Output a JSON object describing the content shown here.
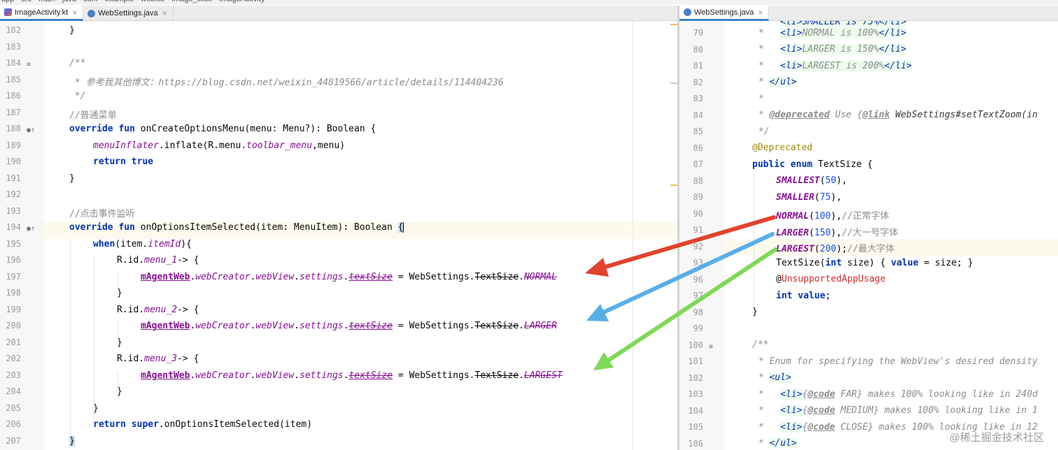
{
  "breadcrumb": [
    "app",
    "src",
    "main",
    "java",
    "com",
    "example",
    "webfile",
    "image_click",
    "ImageActivity"
  ],
  "left_tabs": [
    {
      "label": "ImageActivity.kt",
      "type": "kt",
      "active": true
    },
    {
      "label": "WebSettings.java",
      "type": "java",
      "active": false
    }
  ],
  "right_tabs": [
    {
      "label": "WebSettings.java",
      "type": "java",
      "active": true
    }
  ],
  "left_lines": [
    {
      "n": "182",
      "g": ""
    },
    {
      "n": "183",
      "g": ""
    },
    {
      "n": "184",
      "g": "≡"
    },
    {
      "n": "185",
      "g": ""
    },
    {
      "n": "186",
      "g": ""
    },
    {
      "n": "187",
      "g": ""
    },
    {
      "n": "188",
      "g": "●↑"
    },
    {
      "n": "189",
      "g": ""
    },
    {
      "n": "190",
      "g": ""
    },
    {
      "n": "191",
      "g": ""
    },
    {
      "n": "192",
      "g": ""
    },
    {
      "n": "193",
      "g": ""
    },
    {
      "n": "194",
      "g": "●↑"
    },
    {
      "n": "195",
      "g": ""
    },
    {
      "n": "196",
      "g": ""
    },
    {
      "n": "197",
      "g": ""
    },
    {
      "n": "198",
      "g": ""
    },
    {
      "n": "199",
      "g": ""
    },
    {
      "n": "200",
      "g": ""
    },
    {
      "n": "201",
      "g": ""
    },
    {
      "n": "202",
      "g": ""
    },
    {
      "n": "203",
      "g": ""
    },
    {
      "n": "204",
      "g": ""
    },
    {
      "n": "205",
      "g": ""
    },
    {
      "n": "206",
      "g": ""
    },
    {
      "n": "207",
      "g": ""
    }
  ],
  "right_lines": [
    {
      "n": "79",
      "g": ""
    },
    {
      "n": "80",
      "g": ""
    },
    {
      "n": "81",
      "g": ""
    },
    {
      "n": "82",
      "g": ""
    },
    {
      "n": "83",
      "g": ""
    },
    {
      "n": "84",
      "g": ""
    },
    {
      "n": "85",
      "g": ""
    },
    {
      "n": "86",
      "g": ""
    },
    {
      "n": "87",
      "g": ""
    },
    {
      "n": "88",
      "g": ""
    },
    {
      "n": "89",
      "g": ""
    },
    {
      "n": "90",
      "g": ""
    },
    {
      "n": "91",
      "g": ""
    },
    {
      "n": "92",
      "g": ""
    },
    {
      "n": "93",
      "g": ""
    },
    {
      "n": "96",
      "g": ""
    },
    {
      "n": "97",
      "g": ""
    },
    {
      "n": "98",
      "g": ""
    },
    {
      "n": "99",
      "g": ""
    },
    {
      "n": "100",
      "g": "≡"
    },
    {
      "n": "101",
      "g": ""
    },
    {
      "n": "102",
      "g": ""
    },
    {
      "n": "103",
      "g": ""
    },
    {
      "n": "104",
      "g": ""
    },
    {
      "n": "105",
      "g": ""
    },
    {
      "n": "106",
      "g": ""
    }
  ],
  "code_text": {
    "comment_link_prefix": " * 参考我其他博文：",
    "comment_link_url": "https://blog.csdn.net/weixin_44819566/article/details/114404236",
    "comment_menu": "//普通菜单",
    "comment_click": "//点击事件监听",
    "comment_normal": "//正常字体",
    "comment_larger": "//大一号字体",
    "comment_largest": "//最大字体",
    "menu_1": "menu_1",
    "menu_2": "menu_2",
    "menu_3": "menu_3",
    "enum_normal": "NORMAL",
    "enum_larger": "LARGER",
    "enum_largest": "LARGEST",
    "enum_smallest": "SMALLEST",
    "enum_smaller": "SMALLER",
    "val_normal": "100",
    "val_larger": "150",
    "val_largest": "200",
    "val_smallest": "50",
    "val_smaller": "75",
    "doc_normal": "NORMAL is 100%",
    "doc_larger": "LARGER is 150%",
    "doc_largest": "LARGEST is 200%",
    "deprecated_use": "Use {",
    "link_target": "WebSettings#setTextZoom(in",
    "enum_doc": " * Enum for specifying the WebView's desired density",
    "far": " FAR} makes 100% looking like in 240d",
    "medium": " MEDIUM} makes 100% looking like in 1",
    "close": " CLOSE} makes 100% looking like in 12"
  },
  "arrow_colors": {
    "normal": "#e0442c",
    "larger": "#5aaee8",
    "largest": "#7ed957"
  },
  "watermark": "@稀土掘金技术社区"
}
